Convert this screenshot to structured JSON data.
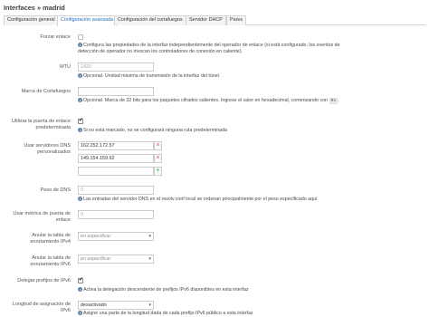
{
  "page": {
    "title": "Interfaces » madrid"
  },
  "tabs": [
    {
      "label": "Configuración general",
      "active": false
    },
    {
      "label": "Configuración avanzada",
      "active": true
    },
    {
      "label": "Configuración del cortafuegos",
      "active": false
    },
    {
      "label": "Servidor DHCP",
      "active": false
    },
    {
      "label": "Pares",
      "active": false
    }
  ],
  "fields": {
    "forzar_enlace": {
      "label": "Forzar enlace",
      "checked": false,
      "description": "Configura las propiedades de la interfaz independientemente del operador de enlace (si está configurado, los eventos de detección de operador no invocan los controladores de conexión en caliente)."
    },
    "mtu": {
      "label": "MTU",
      "placeholder": "1420",
      "description": "Opcional. Unidad máxima de transmisión de la interfaz del túnel."
    },
    "marca_cortafuegos": {
      "label": "Marca de Cortafuegos",
      "value": "",
      "description_prefix": "Opcional. Marca de 32 bits para los paquetes cifrados salientes. Ingrese el valor en hexadecimal, comenzando con",
      "description_code": "0x",
      "description_suffix": "."
    },
    "puerta_enlace": {
      "label_line1": "Utilizar la puerta de enlace",
      "label_line2": "predeterminada",
      "checked": true,
      "description": "Si no está marcado, no se configurará ninguna ruta predeterminada"
    },
    "dns": {
      "label_line1": "Usar servidores DNS",
      "label_line2": "personalizados",
      "entries": [
        "162.252.172.57",
        "149.154.159.92"
      ],
      "remove_symbol": "×",
      "add_symbol": "+",
      "description": "Las entradas del servidor DNS en el resolv.conf local se ordenan principalmente por el peso especificado aquí"
    },
    "peso_dns": {
      "label": "Peso de DNS",
      "placeholder": "0"
    },
    "metrica": {
      "label_line1": "Usar métrica de puerta de",
      "label_line2": "enlace",
      "placeholder": "0"
    },
    "tabla_ipv4": {
      "label_line1": "Anular la tabla de",
      "label_line2": "enrutamiento IPv4",
      "value": "en especificar"
    },
    "tabla_ipv6": {
      "label_line1": "Anular la tabla de",
      "label_line2": "enrutamiento IPv6",
      "value": "en especificar"
    },
    "prefijos_ipv6": {
      "label": "Delegar prefijos de IPv6",
      "checked": true,
      "description": "Activa la delegación descendente de prefijos IPv6 disponibles en esta interfaz"
    },
    "longitud_ipv6": {
      "label_line1": "Longitud de asignación de",
      "label_line2": "IPv6",
      "value": "desactivado",
      "description": "Asigne una parte de la longitud dada de cada prefijo IPv6 público a esta interfaz"
    }
  }
}
